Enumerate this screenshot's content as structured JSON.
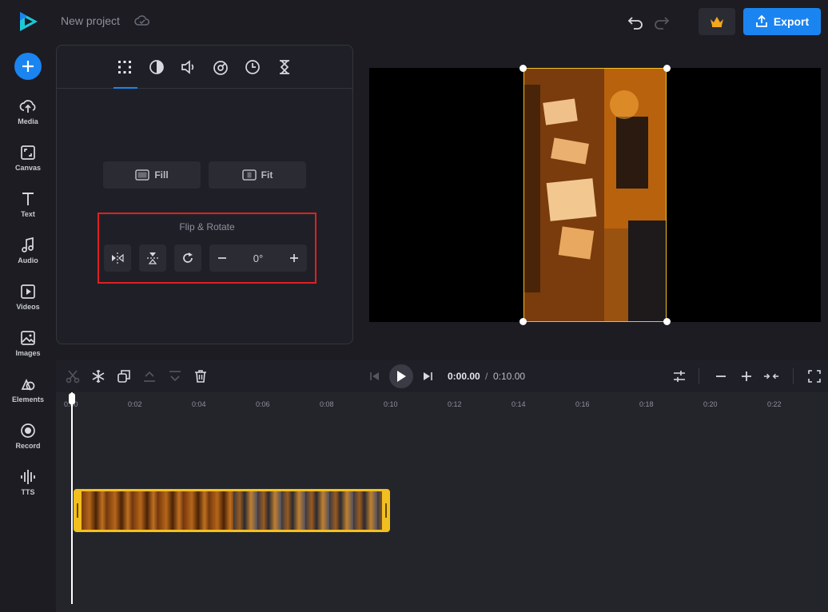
{
  "header": {
    "project_title": "New project",
    "export_label": "Export"
  },
  "sidebar": {
    "items": [
      {
        "label": "Media",
        "icon": "cloud-upload-icon"
      },
      {
        "label": "Canvas",
        "icon": "canvas-icon"
      },
      {
        "label": "Text",
        "icon": "text-icon"
      },
      {
        "label": "Audio",
        "icon": "music-note-icon"
      },
      {
        "label": "Videos",
        "icon": "video-icon"
      },
      {
        "label": "Images",
        "icon": "image-icon"
      },
      {
        "label": "Elements",
        "icon": "shapes-icon"
      },
      {
        "label": "Record",
        "icon": "record-icon"
      },
      {
        "label": "TTS",
        "icon": "waveform-icon"
      }
    ]
  },
  "panel": {
    "tabs": [
      "crop-icon",
      "adjust-icon",
      "volume-icon",
      "speed-icon",
      "clock-icon",
      "hourglass-icon"
    ],
    "active_tab": 0,
    "fill_label": "Fill",
    "fit_label": "Fit",
    "flip_rotate_title": "Flip & Rotate",
    "rotation_value": "0°"
  },
  "timeline": {
    "current_time": "0:00.00",
    "separator": "/",
    "total_time": "0:10.00",
    "ruler_ticks": [
      "0:00",
      "0:02",
      "0:04",
      "0:06",
      "0:08",
      "0:10",
      "0:12",
      "0:14",
      "0:16",
      "0:18",
      "0:20",
      "0:22"
    ]
  },
  "colors": {
    "accent": "#1a84f0",
    "highlight_border": "#e02020",
    "clip": "#f2c01e"
  }
}
